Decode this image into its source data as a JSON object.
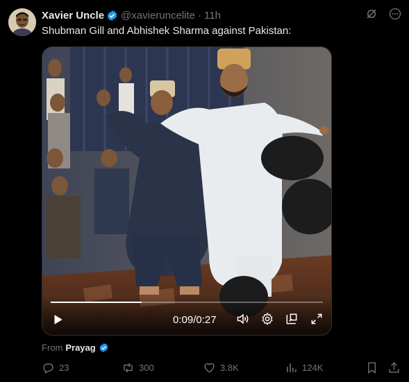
{
  "author": {
    "name": "Xavier Uncle",
    "handle": "@xavieruncelite",
    "dot": "·",
    "time": "11h"
  },
  "tweet_text": "Shubman Gill and Abhishek Sharma against Pakistan:",
  "video": {
    "current_time": "0:09",
    "separator": "/",
    "duration": "0:27",
    "progress": 0.333
  },
  "from": {
    "label": "From",
    "source": "Prayag"
  },
  "actions": {
    "replies": "23",
    "reposts": "300",
    "likes": "3.8K",
    "views": "124K"
  },
  "colors": {
    "verified": "#1d9bf0",
    "muted": "#71767b",
    "text": "#e7e9ea",
    "background": "#000000"
  },
  "icons": [
    "grok-icon",
    "more-icon",
    "verified-badge-icon",
    "play-icon",
    "volume-icon",
    "settings-icon",
    "pip-icon",
    "fullscreen-icon",
    "reply-icon",
    "repost-icon",
    "like-icon",
    "views-icon",
    "bookmark-icon",
    "share-icon"
  ]
}
